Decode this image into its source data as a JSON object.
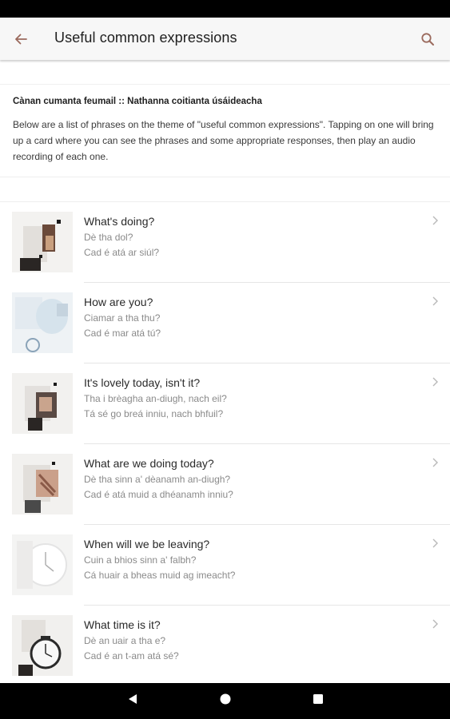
{
  "header": {
    "title": "Useful common expressions",
    "back_icon": "arrow-left-icon",
    "search_icon": "search-icon",
    "accent_color": "#9b6a5d"
  },
  "intro": {
    "heading": "Cànan cumanta feumail :: Nathanna coitianta úsáideacha",
    "description": "Below are a list of phrases on the theme of \"useful common expressions\". Tapping on one will bring up a card where you can see the phrases and some appropriate responses, then play an audio recording of each one."
  },
  "phrases": [
    {
      "english": "What's doing?",
      "gaelic": "Dè tha dol?",
      "irish": "Cad é atá ar siúl?"
    },
    {
      "english": "How are you?",
      "gaelic": "Ciamar a tha thu?",
      "irish": "Cad é mar atá tú?"
    },
    {
      "english": "It's lovely today, isn't it?",
      "gaelic": "Tha i brèagha an-diugh, nach eil?",
      "irish": "Tá sé go breá inniu, nach bhfuil?"
    },
    {
      "english": "What are we doing today?",
      "gaelic": "Dè tha sinn a' dèanamh an-diugh?",
      "irish": "Cad é atá muid a dhéanamh inniu?"
    },
    {
      "english": "When will we be leaving?",
      "gaelic": "Cuin a bhios sinn a' falbh?",
      "irish": "Cá huair a bheas muid ag imeacht?"
    },
    {
      "english": "What time is it?",
      "gaelic": "Dè an uair a tha e?",
      "irish": "Cad é an t-am atá sé?"
    }
  ],
  "navigation": {
    "back_icon": "triangle-back-icon",
    "home_icon": "circle-home-icon",
    "recents_icon": "square-recents-icon"
  }
}
